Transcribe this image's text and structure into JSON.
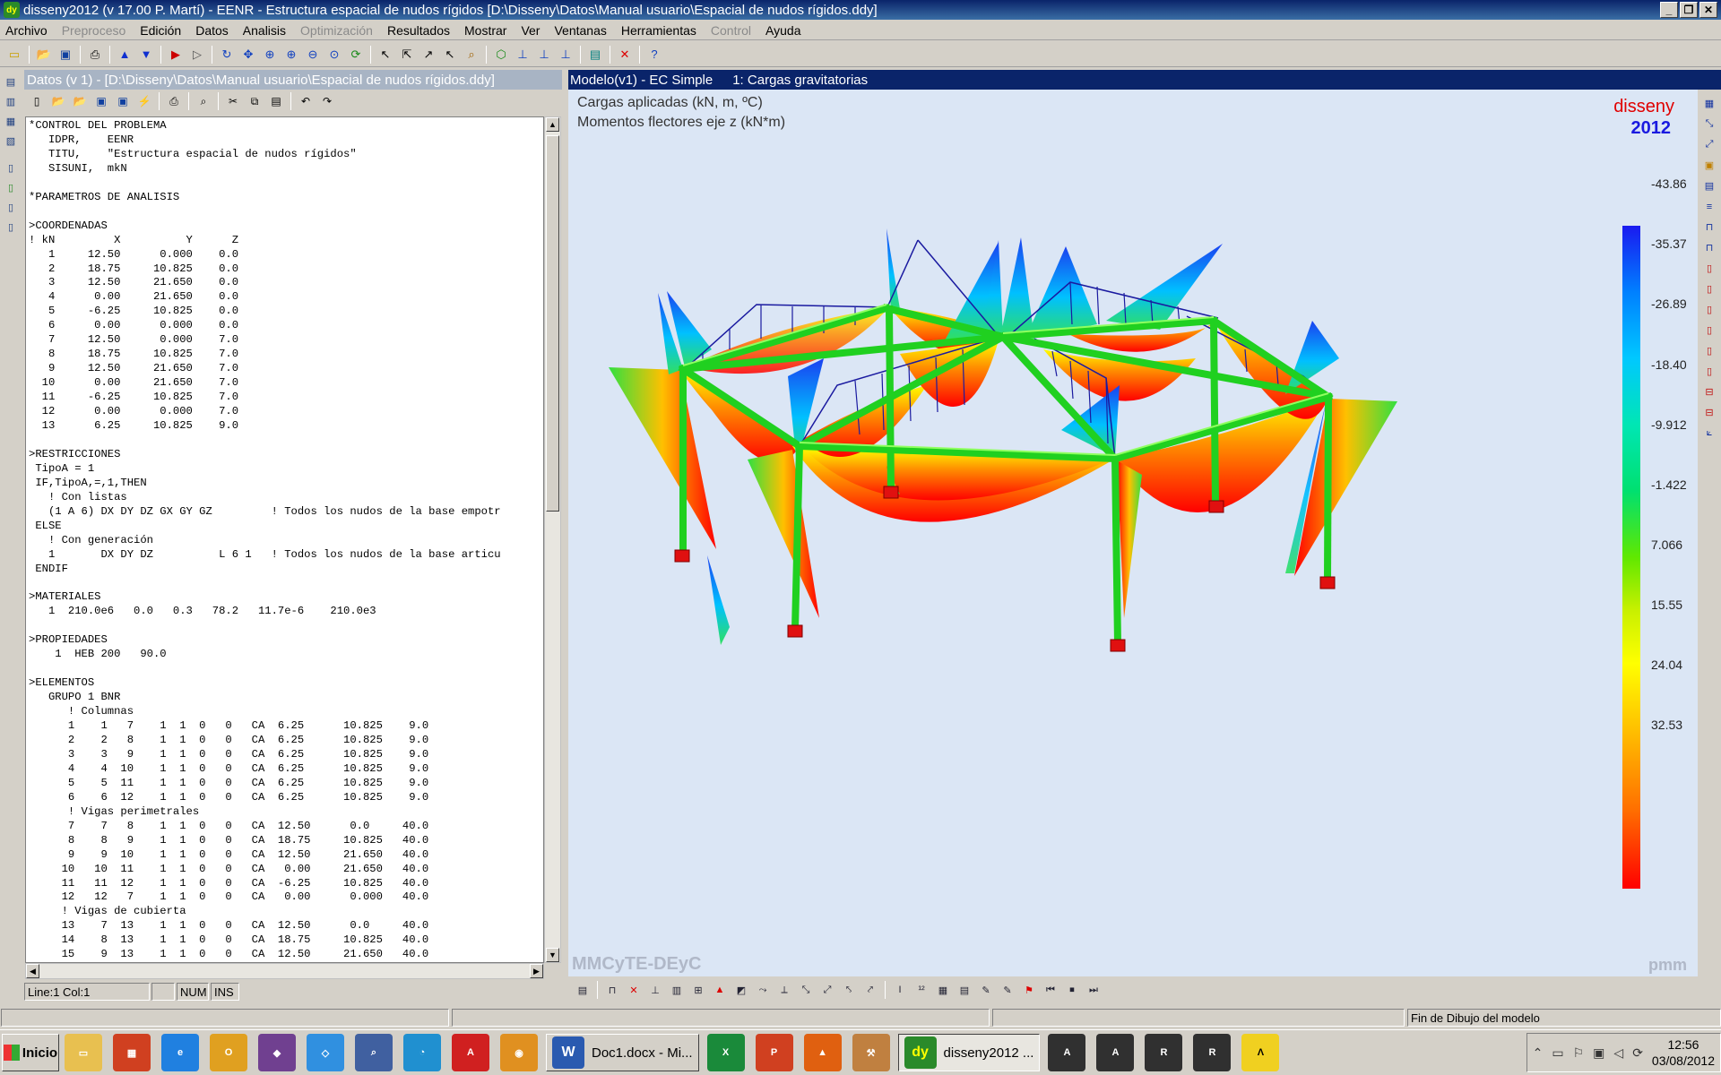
{
  "window": {
    "title": "disseny2012 (v 17.00 P. Martí) - EENR - Estructura espacial de nudos rígidos [D:\\Disseny\\Datos\\Manual usuario\\Espacial de nudos rígidos.ddy]",
    "app_icon": "dy"
  },
  "menu": [
    "Archivo",
    "Preproceso",
    "Edición",
    "Datos",
    "Analisis",
    "Optimización",
    "Resultados",
    "Mostrar",
    "Ver",
    "Ventanas",
    "Herramientas",
    "Control",
    "Ayuda"
  ],
  "menu_disabled": [
    "Preproceso",
    "Optimización",
    "Control"
  ],
  "data_window": {
    "title": "Datos (v 1) - [D:\\Disseny\\Datos\\Manual usuario\\Espacial de nudos rígidos.ddy]",
    "text": "*CONTROL DEL PROBLEMA\n   IDPR,    EENR\n   TITU,    \"Estructura espacial de nudos rígidos\"\n   SISUNI,  mkN\n\n*PARAMETROS DE ANALISIS\n\n>COORDENADAS\n! kN         X          Y      Z\n   1     12.50      0.000    0.0\n   2     18.75     10.825    0.0\n   3     12.50     21.650    0.0\n   4      0.00     21.650    0.0\n   5     -6.25     10.825    0.0\n   6      0.00      0.000    0.0\n   7     12.50      0.000    7.0\n   8     18.75     10.825    7.0\n   9     12.50     21.650    7.0\n  10      0.00     21.650    7.0\n  11     -6.25     10.825    7.0\n  12      0.00      0.000    7.0\n  13      6.25     10.825    9.0\n\n>RESTRICCIONES\n TipoA = 1\n IF,TipoA,=,1,THEN\n   ! Con listas\n   (1 A 6) DX DY DZ GX GY GZ         ! Todos los nudos de la base empotr\n ELSE\n   ! Con generación\n   1       DX DY DZ          L 6 1   ! Todos los nudos de la base articu\n ENDIF\n\n>MATERIALES\n   1  210.0e6   0.0   0.3   78.2   11.7e-6    210.0e3\n\n>PROPIEDADES\n    1  HEB 200   90.0\n\n>ELEMENTOS\n   GRUPO 1 BNR\n      ! Columnas\n      1    1   7    1  1  0   0   CA  6.25      10.825    9.0\n      2    2   8    1  1  0   0   CA  6.25      10.825    9.0\n      3    3   9    1  1  0   0   CA  6.25      10.825    9.0\n      4    4  10    1  1  0   0   CA  6.25      10.825    9.0\n      5    5  11    1  1  0   0   CA  6.25      10.825    9.0\n      6    6  12    1  1  0   0   CA  6.25      10.825    9.0\n      ! Vigas perimetrales\n      7    7   8    1  1  0   0   CA  12.50      0.0     40.0\n      8    8   9    1  1  0   0   CA  18.75     10.825   40.0\n      9    9  10    1  1  0   0   CA  12.50     21.650   40.0\n     10   10  11    1  1  0   0   CA   0.00     21.650   40.0\n     11   11  12    1  1  0   0   CA  -6.25     10.825   40.0\n     12   12   7    1  1  0   0   CA   0.00      0.000   40.0\n     ! Vigas de cubierta\n     13    7  13    1  1  0   0   CA  12.50      0.0     40.0\n     14    8  13    1  1  0   0   CA  18.75     10.825   40.0\n     15    9  13    1  1  0   0   CA  12.50     21.650   40.0",
    "status": {
      "position": "Line:1  Col:1",
      "num": "NUM",
      "ins": "INS"
    }
  },
  "model_window": {
    "title": "Modelo(v1) - EC Simple",
    "load_case": "1: Cargas gravitatorias",
    "line1": "Cargas aplicadas (kN, m, ºC)",
    "line2": "Momentos flectores eje z (kN*m)",
    "brand_name": "disseny",
    "brand_year": "2012",
    "watermark_left": "MMCyTE-DEyC",
    "watermark_right": "pmm",
    "legend_values": [
      "-43.86",
      "-35.37",
      "-26.89",
      "-18.40",
      "-9.912",
      "-1.422",
      "7.066",
      "15.55",
      "24.04",
      "32.53"
    ]
  },
  "statusbar": {
    "message": "Fin de Dibujo del modelo"
  },
  "taskbar": {
    "start": "Inicio",
    "word_task": "Doc1.docx - Mi...",
    "disseny_task": "disseny2012 ...",
    "time": "12:56",
    "date": "03/08/2012"
  }
}
